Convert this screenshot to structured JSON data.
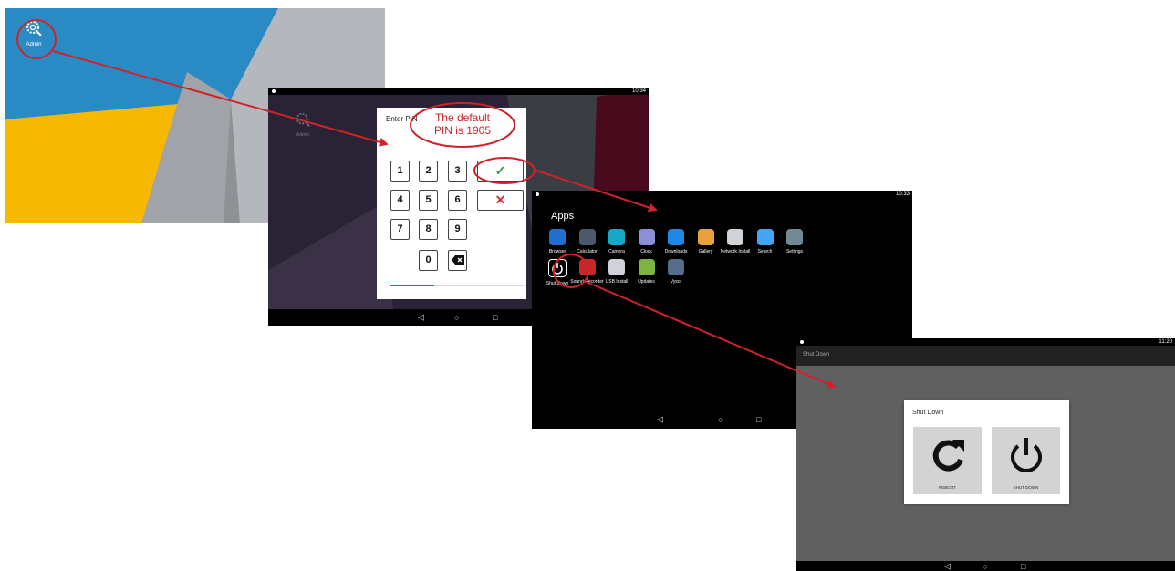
{
  "home": {
    "admin_label": "Admin"
  },
  "pin_screen": {
    "status_time": "10:34",
    "dialog_title": "Enter PIN",
    "faded_admin_label": "Admin",
    "keys": [
      "1",
      "2",
      "3",
      "4",
      "5",
      "6",
      "7",
      "8",
      "9",
      "0"
    ],
    "confirm_icon": "checkmark-icon",
    "cancel_icon": "x-icon",
    "delete_icon": "backspace-icon",
    "progress_fraction": 0.33,
    "nav": {
      "back": "◁",
      "home": "○",
      "recents": "□"
    }
  },
  "callout": {
    "line1": "The default",
    "line2": "PIN is 1905"
  },
  "apps_screen": {
    "status_time": "10:33",
    "title": "Apps",
    "apps": [
      {
        "label": "Browser",
        "color": "#1e6fcf"
      },
      {
        "label": "Calculator",
        "color": "#4a5a6a"
      },
      {
        "label": "Camera",
        "color": "#19a7c9"
      },
      {
        "label": "Clock",
        "color": "#8a8fd8"
      },
      {
        "label": "Downloads",
        "color": "#1e88e5"
      },
      {
        "label": "Gallery",
        "color": "#e9a13b"
      },
      {
        "label": "Network Install",
        "color": "#cfd2d6"
      },
      {
        "label": "Search",
        "color": "#42a5f5"
      },
      {
        "label": "Settings",
        "color": "#6f8a95"
      },
      {
        "label": "Shut Down",
        "color": "#111111"
      },
      {
        "label": "Sound Recorder",
        "color": "#c62828"
      },
      {
        "label": "USB Install",
        "color": "#cfd2d6"
      },
      {
        "label": "Updates",
        "color": "#7cb342"
      },
      {
        "label": "Vysor",
        "color": "#546e8a"
      }
    ],
    "nav": {
      "back": "◁",
      "home": "○",
      "recents": "□"
    }
  },
  "shutdown_screen": {
    "status_time": "11:20",
    "appbar_title": "Shut Down",
    "dialog_title": "Shut Down",
    "reboot_label": "REBOOT",
    "shutdown_label": "SHUT DOWN",
    "nav": {
      "back": "◁",
      "home": "○",
      "recents": "□"
    }
  },
  "colors": {
    "annotation_red": "#d0222a"
  }
}
